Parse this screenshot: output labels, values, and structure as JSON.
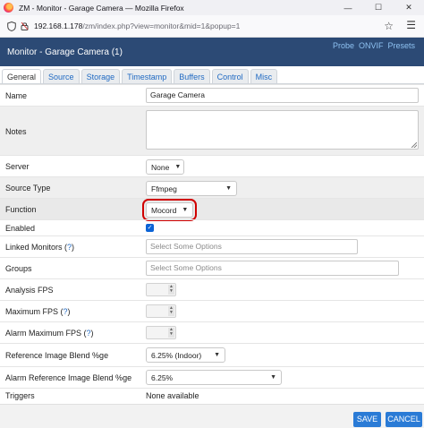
{
  "window": {
    "title": "ZM - Monitor - Garage Camera — Mozilla Firefox",
    "buttons": [
      "—",
      "☐",
      "✕"
    ]
  },
  "urlbar": {
    "host": "192.168.1.178",
    "path": "/zm/index.php?view=monitor&mid=1&popup=1",
    "star_icon": "star-icon",
    "menu_icon": "hamburger-menu-icon"
  },
  "header": {
    "title": "Monitor - Garage Camera (1)",
    "links": [
      "Probe",
      "ONVIF",
      "Presets"
    ]
  },
  "tabs": [
    "General",
    "Source",
    "Storage",
    "Timestamp",
    "Buffers",
    "Control",
    "Misc"
  ],
  "active_tab": "General",
  "form": {
    "name": {
      "label": "Name",
      "value": "Garage Camera"
    },
    "notes": {
      "label": "Notes",
      "value": ""
    },
    "server": {
      "label": "Server",
      "value": "None"
    },
    "source_type": {
      "label": "Source Type",
      "value": "Ffmpeg"
    },
    "function": {
      "label": "Function",
      "value": "Mocord"
    },
    "enabled": {
      "label": "Enabled",
      "checked": true
    },
    "linked_monitors": {
      "label": "Linked Monitors (",
      "help": "?",
      "close": ")",
      "placeholder": "Select Some Options"
    },
    "groups": {
      "label": "Groups",
      "placeholder": "Select Some Options"
    },
    "analysis_fps": {
      "label": "Analysis FPS",
      "value": ""
    },
    "maximum_fps": {
      "label": "Maximum FPS (",
      "help": "?",
      "close": ")",
      "value": ""
    },
    "alarm_maximum_fps": {
      "label": "Alarm Maximum FPS (",
      "help": "?",
      "close": ")",
      "value": ""
    },
    "ref_blend": {
      "label": "Reference Image Blend %ge",
      "value": "6.25% (Indoor)"
    },
    "alarm_ref_blend": {
      "label": "Alarm Reference Image Blend %ge",
      "value": "6.25%"
    },
    "triggers": {
      "label": "Triggers",
      "value": "None available"
    }
  },
  "footer": {
    "save": "SAVE",
    "cancel": "CANCEL"
  },
  "colors": {
    "header_bg": "#2c4a75",
    "accent": "#2a7bd6",
    "highlight_box": "#d00000"
  }
}
